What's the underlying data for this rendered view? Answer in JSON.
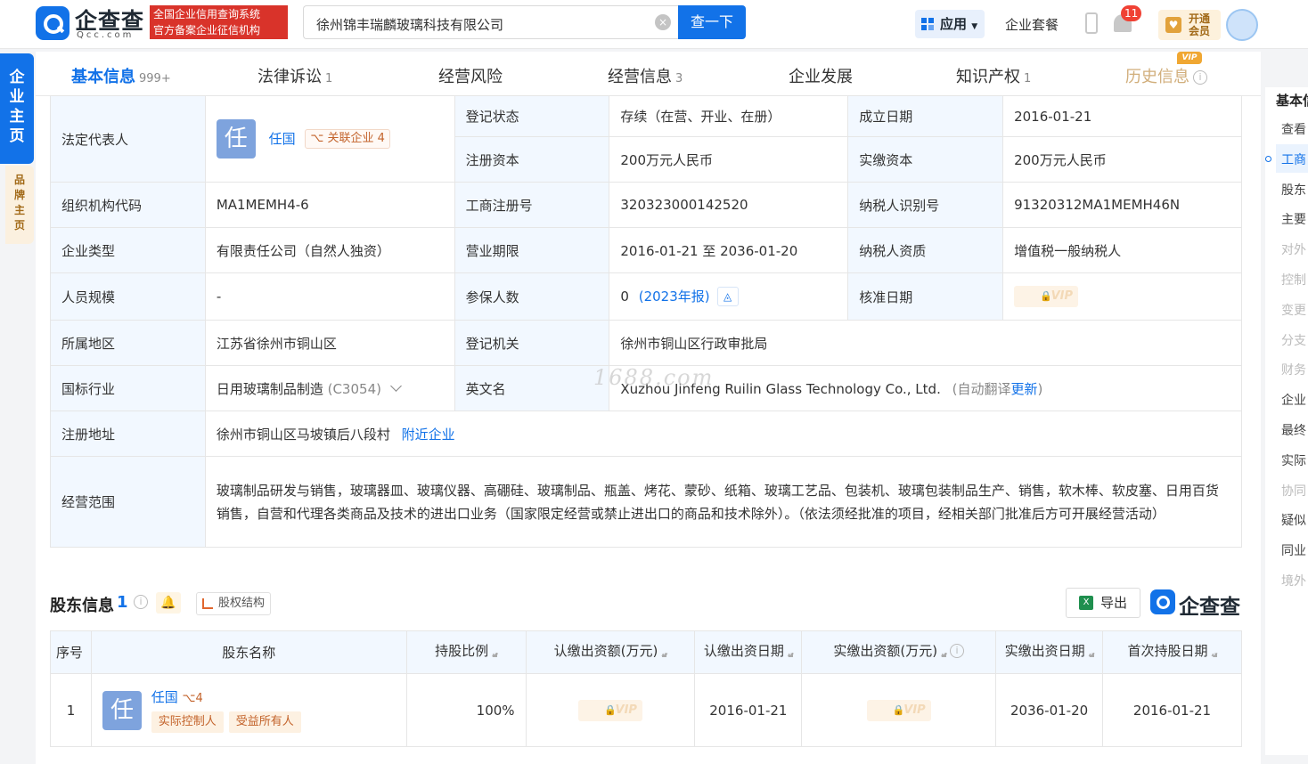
{
  "header": {
    "logo_text": "企查查",
    "logo_sub": "Qcc.com",
    "badge_line1": "全国企业信用查询系统",
    "badge_line2": "官方备案企业征信机构",
    "search_value": "徐州锦丰瑞麟玻璃科技有限公司",
    "search_clear": "×",
    "search_button": "查一下",
    "app_button": "应用",
    "package_link": "企业套餐",
    "notification_count": "11",
    "vip_line1": "开通",
    "vip_line2": "会员"
  },
  "side_nav": {
    "main": "企业主页",
    "brand": "品牌主页"
  },
  "tabs": [
    {
      "label": "基本信息",
      "count": "999+"
    },
    {
      "label": "法律诉讼",
      "count": "1"
    },
    {
      "label": "经营风险",
      "count": ""
    },
    {
      "label": "经营信息",
      "count": "3"
    },
    {
      "label": "企业发展",
      "count": ""
    },
    {
      "label": "知识产权",
      "count": "1"
    },
    {
      "label": "历史信息",
      "count": ""
    }
  ],
  "vip_tag": "VIP",
  "basic": {
    "legal_rep_label": "法定代表人",
    "legal_rep_avatar": "任",
    "legal_rep_name": "任国",
    "related_label": "关联企业",
    "related_count": "4",
    "reg_status_label": "登记状态",
    "reg_status": "存续（在营、开业、在册）",
    "found_date_label": "成立日期",
    "found_date": "2016-01-21",
    "reg_capital_label": "注册资本",
    "reg_capital": "200万元人民币",
    "paid_capital_label": "实缴资本",
    "paid_capital": "200万元人民币",
    "org_code_label": "组织机构代码",
    "org_code": "MA1MEMH4-6",
    "biz_reg_no_label": "工商注册号",
    "biz_reg_no": "320323000142520",
    "tax_id_label": "纳税人识别号",
    "tax_id": "91320312MA1MEMH46N",
    "type_label": "企业类型",
    "type": "有限责任公司（自然人独资）",
    "term_label": "营业期限",
    "term": "2016-01-21 至 2036-01-20",
    "tax_qual_label": "纳税人资质",
    "tax_qual": "增值税一般纳税人",
    "staff_label": "人员规模",
    "staff": "-",
    "insured_label": "参保人数",
    "insured": "0",
    "insured_year": "(2023年报)",
    "approval_label": "核准日期",
    "region_label": "所属地区",
    "region": "江苏省徐州市铜山区",
    "authority_label": "登记机关",
    "authority": "徐州市铜山区行政审批局",
    "industry_label": "国标行业",
    "industry": "日用玻璃制品制造",
    "industry_code": "(C3054)",
    "en_name_label": "英文名",
    "en_name": "Xuzhou Jinfeng Ruilin Glass Technology Co., Ltd.",
    "auto_translate": "(自动翻译",
    "update_link": "更新",
    "close_paren": ")",
    "address_label": "注册地址",
    "address": "徐州市铜山区马坡镇后八段村",
    "nearby_link": "附近企业",
    "scope_label": "经营范围",
    "scope": "玻璃制品研发与销售，玻璃器皿、玻璃仪器、高硼硅、玻璃制品、瓶盖、烤花、蒙砂、纸箱、玻璃工艺品、包装机、玻璃包装制品生产、销售，软木棒、软皮塞、日用百货销售，自营和代理各类商品及技术的进出口业务（国家限定经营或禁止进出口的商品和技术除外）。（依法须经批准的项目，经相关部门批准后方可开展经营活动）"
  },
  "watermark": "1688.com",
  "shareholders": {
    "title": "股东信息",
    "count": "1",
    "equity_button": "股权结构",
    "export_button": "导出",
    "brand_text": "企查查",
    "columns": [
      "序号",
      "股东名称",
      "持股比例",
      "认缴出资额(万元)",
      "认缴出资日期",
      "实缴出资额(万元)",
      "实缴出资日期",
      "首次持股日期"
    ],
    "rows": [
      {
        "no": "1",
        "avatar": "任",
        "name": "任国",
        "related": "4",
        "tag1": "实际控制人",
        "tag2": "受益所有人",
        "ratio": "100%",
        "sub_date": "2016-01-21",
        "paid_date": "2036-01-20",
        "first_date": "2016-01-21"
      }
    ]
  },
  "right_nav": {
    "title": "基本信",
    "items": [
      "查看",
      "工商",
      "股东",
      "主要",
      "对外",
      "控制",
      "变更",
      "分支",
      "财务",
      "企业",
      "最终",
      "实际",
      "协同",
      "疑似",
      "同业",
      "境外"
    ]
  }
}
